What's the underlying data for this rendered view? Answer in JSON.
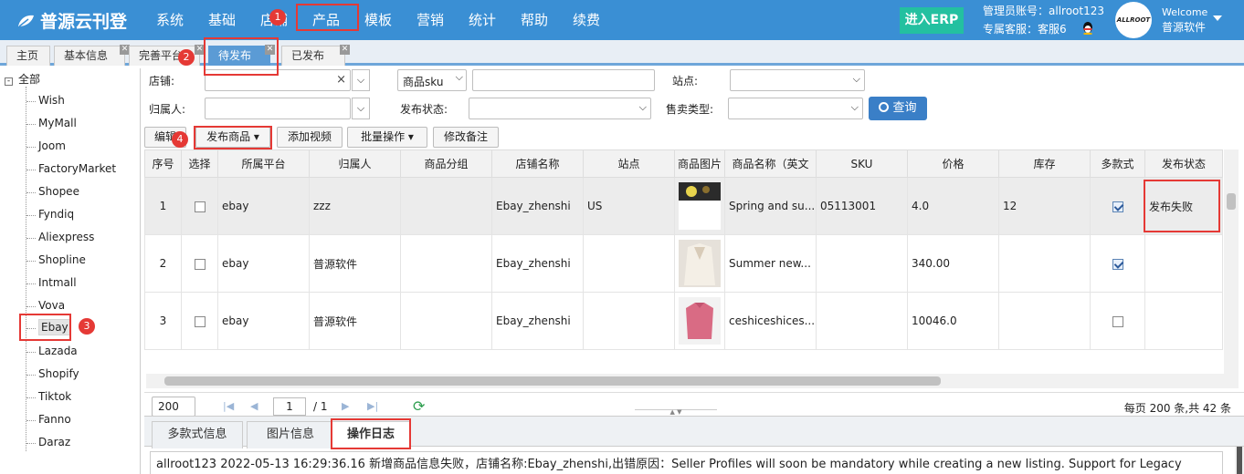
{
  "app": {
    "title": "普源云刊登"
  },
  "nav": [
    "系统",
    "基础",
    "店铺",
    "产品",
    "模板",
    "营销",
    "统计",
    "帮助",
    "续费"
  ],
  "erp_button": "进入ERP",
  "account": {
    "line1": "管理员账号：allroot123",
    "line2": "专属客服：客服6"
  },
  "avatar_text": "ALLROOT",
  "welcome": {
    "label": "Welcome",
    "name": "普源软件"
  },
  "tabs": [
    "主页",
    "基本信息",
    "完善平台",
    "待发布",
    "已发布"
  ],
  "badges": [
    "1",
    "2",
    "3",
    "4"
  ],
  "sidebar": {
    "root": "全部",
    "items": [
      "Wish",
      "MyMall",
      "Joom",
      "FactoryMarket",
      "Shopee",
      "Fyndiq",
      "Aliexpress",
      "Shopline",
      "Intmall",
      "Vova",
      "Ebay",
      "Lazada",
      "Shopify",
      "Tiktok",
      "Fanno",
      "Daraz"
    ]
  },
  "filters": {
    "shop_label": "店铺:",
    "sku_select": "商品sku",
    "site_label": "站点:",
    "owner_label": "归属人:",
    "status_label": "发布状态:",
    "sale_type_label": "售卖类型:",
    "clear_glyph": "×",
    "query_button": "查询"
  },
  "toolbar": {
    "edit": "编辑",
    "publish": "发布商品",
    "add_video": "添加视频",
    "batch": "批量操作",
    "modify_note": "修改备注"
  },
  "grid": {
    "headers": [
      "序号",
      "选择",
      "所属平台",
      "归属人",
      "商品分组",
      "店铺名称",
      "站点",
      "商品图片",
      "商品名称（英文",
      "SKU",
      "价格",
      "库存",
      "多款式",
      "发布状态"
    ],
    "rows": [
      {
        "no": "1",
        "platform": "ebay",
        "owner": "zzz",
        "group": "",
        "shop": "Ebay_zhenshi",
        "site": "US",
        "name": "Spring and su...",
        "sku": "05113001",
        "price": "4.0",
        "stock": "12",
        "multi": true,
        "status": "发布失败"
      },
      {
        "no": "2",
        "platform": "ebay",
        "owner": "普源软件",
        "group": "",
        "shop": "Ebay_zhenshi",
        "site": "",
        "name": "Summer new...",
        "sku": "",
        "price": "340.00",
        "stock": "",
        "multi": true,
        "status": ""
      },
      {
        "no": "3",
        "platform": "ebay",
        "owner": "普源软件",
        "group": "",
        "shop": "Ebay_zhenshi",
        "site": "",
        "name": "ceshiceshices...",
        "sku": "",
        "price": "10046.0",
        "stock": "",
        "multi": false,
        "status": ""
      }
    ]
  },
  "pager": {
    "page_size": "200",
    "page": "1",
    "total_pages": "/ 1",
    "summary": "每页 200 条,共 42 条"
  },
  "bottom_tabs": [
    "多款式信息",
    "图片信息",
    "操作日志"
  ],
  "log_line": "allroot123 2022-05-13 16:29:36.16 新增商品信息失败，店铺名称:Ebay_zhenshi,出错原因：Seller Profiles will soon be mandatory while creating a new listing. Support for Legacy"
}
